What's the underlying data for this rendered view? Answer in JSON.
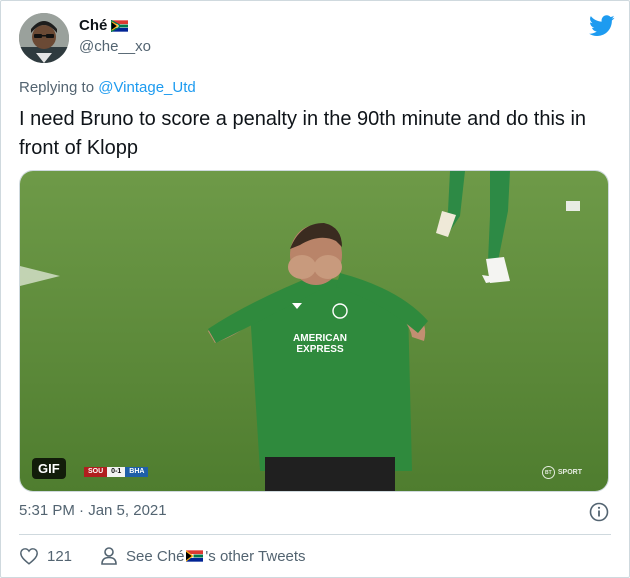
{
  "tweet": {
    "author_name": "Ché",
    "author_flag": "south-africa-flag",
    "handle": "@che__xo",
    "replying_prefix": "Replying to ",
    "replying_to": "@Vintage_Utd",
    "text": "I need Bruno to score a penalty in the 90th minute and do this in front of Klopp",
    "timestamp": "5:31 PM · Jan 5, 2021",
    "like_count": "121",
    "other_tweets_prefix": "See Ché",
    "other_tweets_suffix": "'s other Tweets"
  },
  "media": {
    "badge": "GIF",
    "jersey_text_line1": "AMERICAN",
    "jersey_text_line2": "EXPRESS",
    "score_home": "SOU",
    "score": "0-1",
    "score_away": "BHA",
    "broadcaster": "SPORT"
  },
  "colors": {
    "twitter_blue": "#1d9bf0",
    "secondary_text": "#536471",
    "pitch_green": "#5f8f3c",
    "jersey_green": "#2f8a3d"
  }
}
